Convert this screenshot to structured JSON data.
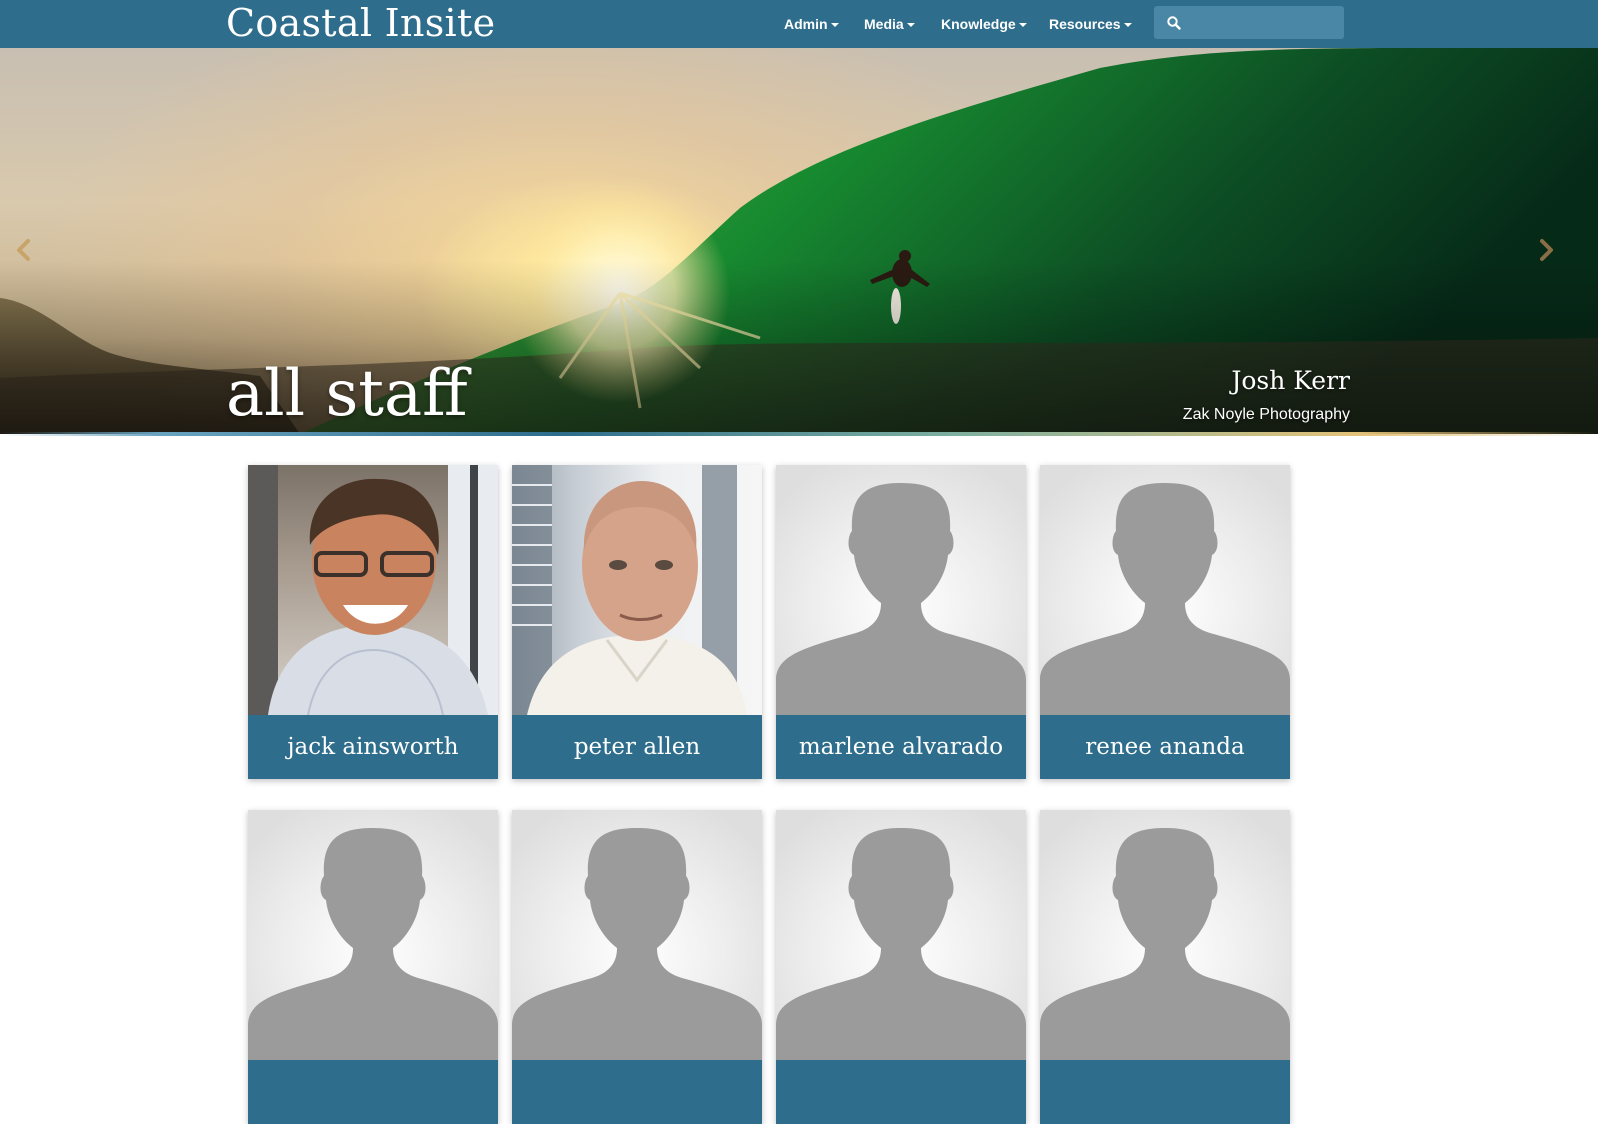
{
  "header": {
    "brand": "Coastal Insite",
    "nav": [
      {
        "label": "Admin"
      },
      {
        "label": "Media"
      },
      {
        "label": "Knowledge"
      },
      {
        "label": "Resources"
      }
    ],
    "search": {
      "placeholder": "",
      "value": ""
    }
  },
  "hero": {
    "title": "all staff",
    "credit_name": "Josh Kerr",
    "credit_source": "Zak Noyle Photography"
  },
  "staff": [
    {
      "name": "jack ainsworth",
      "photo": "photo"
    },
    {
      "name": "peter allen",
      "photo": "photo"
    },
    {
      "name": "marlene alvarado",
      "photo": "placeholder"
    },
    {
      "name": "renee ananda",
      "photo": "placeholder"
    },
    {
      "name": "",
      "photo": "placeholder"
    },
    {
      "name": "",
      "photo": "placeholder"
    },
    {
      "name": "",
      "photo": "placeholder"
    },
    {
      "name": "",
      "photo": "placeholder"
    }
  ],
  "colors": {
    "navbar": "#2e6d8c",
    "name_bar": "#2e6d8c",
    "placeholder_silhouette": "#9b9b9b"
  },
  "icons": {
    "search": "search-icon",
    "prev": "chevron-left-icon",
    "next": "chevron-right-icon",
    "dropdown": "caret-down-icon",
    "avatar_placeholder": "person-silhouette-icon"
  }
}
